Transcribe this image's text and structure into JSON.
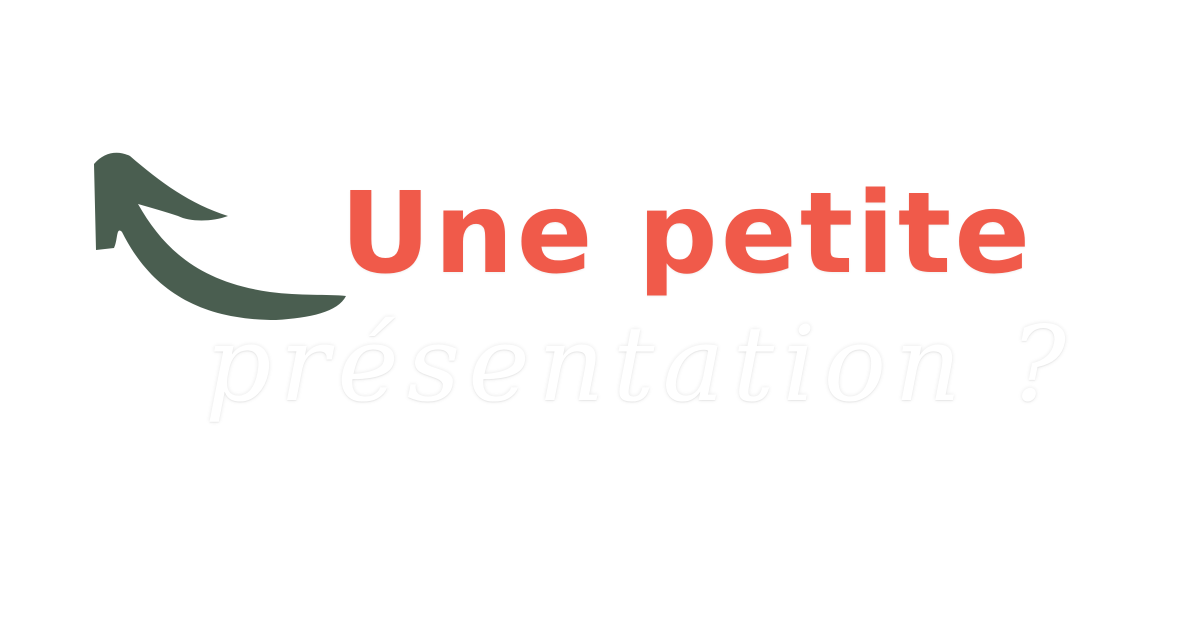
{
  "headline": {
    "text": "Une petite",
    "color": "#f05a4a"
  },
  "subline": {
    "text": "présentation ?",
    "color": "#ffffff"
  },
  "arrow": {
    "icon": "curved-arrow-up-left-icon",
    "color": "#4a5e50"
  }
}
